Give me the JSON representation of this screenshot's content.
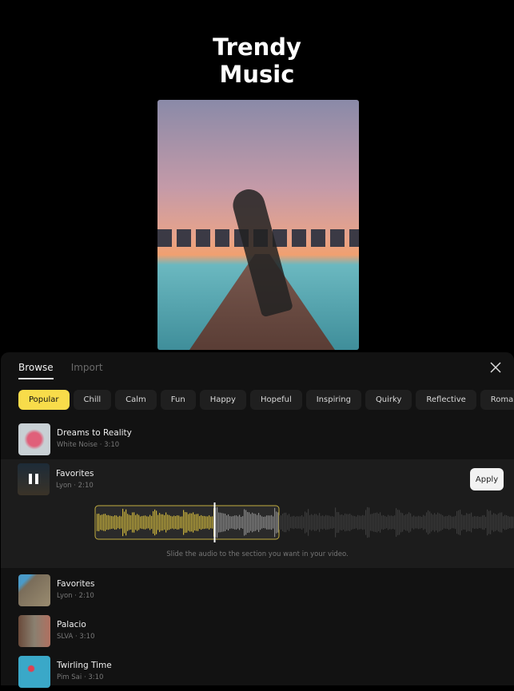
{
  "header": {
    "title_line1": "Trendy",
    "title_line2": "Music"
  },
  "tabs": [
    {
      "label": "Browse",
      "active": true
    },
    {
      "label": "Import",
      "active": false
    }
  ],
  "chips": [
    {
      "label": "Popular",
      "active": true
    },
    {
      "label": "Chill"
    },
    {
      "label": "Calm"
    },
    {
      "label": "Fun"
    },
    {
      "label": "Happy"
    },
    {
      "label": "Hopeful"
    },
    {
      "label": "Inspiring"
    },
    {
      "label": "Quirky"
    },
    {
      "label": "Reflective"
    },
    {
      "label": "Romantic"
    }
  ],
  "tracks": [
    {
      "name": "Dreams to Reality",
      "meta": "White Noise · 3:10"
    },
    {
      "name": "Favorites",
      "meta": "Lyon · 2:10",
      "playing": true
    },
    {
      "name": "Favorites",
      "meta": "Lyon · 2:10"
    },
    {
      "name": "Palacio",
      "meta": "SLVA · 3:10"
    },
    {
      "name": "Twirling Time",
      "meta": "Pim Sai · 3:10"
    }
  ],
  "selected": {
    "apply_label": "Apply",
    "hint": "Slide the audio to the section you want in your video.",
    "progress": 0.65
  },
  "colors": {
    "accent": "#f8dc4a",
    "waveform_played": "#c9b23c",
    "waveform_unplayed": "#8a8a8a",
    "waveform_outside": "#3c3c3c"
  }
}
